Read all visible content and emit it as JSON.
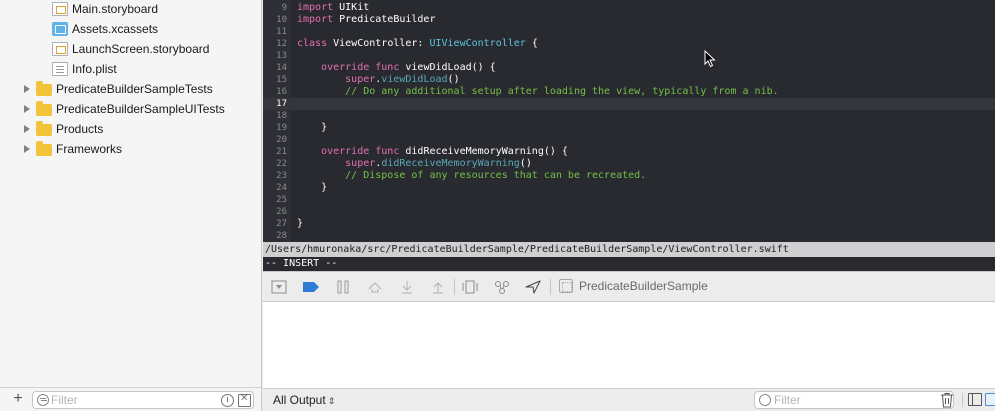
{
  "navigator": {
    "items": [
      {
        "label": "Main.storyboard",
        "icon": "storyboard-icon",
        "expandable": false
      },
      {
        "label": "Assets.xcassets",
        "icon": "asset-catalog-icon",
        "expandable": false
      },
      {
        "label": "LaunchScreen.storyboard",
        "icon": "storyboard-icon",
        "expandable": false
      },
      {
        "label": "Info.plist",
        "icon": "plist-icon",
        "expandable": false
      },
      {
        "label": "PredicateBuilderSampleTests",
        "icon": "folder-icon",
        "expandable": true
      },
      {
        "label": "PredicateBuilderSampleUITests",
        "icon": "folder-icon",
        "expandable": true
      },
      {
        "label": "Products",
        "icon": "folder-icon",
        "expandable": true
      },
      {
        "label": "Frameworks",
        "icon": "folder-icon",
        "expandable": true
      }
    ],
    "filter_placeholder": "Filter"
  },
  "editor": {
    "current_line": 17,
    "lines": [
      {
        "num": "9",
        "tokens": [
          {
            "t": "import",
            "c": "kw"
          },
          {
            "t": " UIKit",
            "c": "plain"
          }
        ]
      },
      {
        "num": "10",
        "tokens": [
          {
            "t": "import",
            "c": "kw"
          },
          {
            "t": " PredicateBuilder",
            "c": "plain"
          }
        ]
      },
      {
        "num": "11",
        "tokens": []
      },
      {
        "num": "12",
        "tokens": [
          {
            "t": "class",
            "c": "kw"
          },
          {
            "t": " ViewController: ",
            "c": "plain"
          },
          {
            "t": "UIViewController",
            "c": "type"
          },
          {
            "t": " {",
            "c": "plain"
          }
        ]
      },
      {
        "num": "13",
        "tokens": []
      },
      {
        "num": "14",
        "tokens": [
          {
            "t": "    override func",
            "c": "kw"
          },
          {
            "t": " viewDidLoad() {",
            "c": "plain"
          }
        ]
      },
      {
        "num": "15",
        "tokens": [
          {
            "t": "        super",
            "c": "kw"
          },
          {
            "t": ".",
            "c": "plain"
          },
          {
            "t": "viewDidLoad",
            "c": "fn"
          },
          {
            "t": "()",
            "c": "plain"
          }
        ]
      },
      {
        "num": "16",
        "tokens": [
          {
            "t": "        // Do any additional setup after loading the view, typically from a nib.",
            "c": "cm"
          }
        ]
      },
      {
        "num": "17",
        "tokens": []
      },
      {
        "num": "18",
        "tokens": []
      },
      {
        "num": "19",
        "tokens": [
          {
            "t": "    }",
            "c": "plain"
          }
        ]
      },
      {
        "num": "20",
        "tokens": []
      },
      {
        "num": "21",
        "tokens": [
          {
            "t": "    override func",
            "c": "kw"
          },
          {
            "t": " didReceiveMemoryWarning() {",
            "c": "plain"
          }
        ]
      },
      {
        "num": "22",
        "tokens": [
          {
            "t": "        super",
            "c": "kw"
          },
          {
            "t": ".",
            "c": "plain"
          },
          {
            "t": "didReceiveMemoryWarning",
            "c": "fn"
          },
          {
            "t": "()",
            "c": "plain"
          }
        ]
      },
      {
        "num": "23",
        "tokens": [
          {
            "t": "        // Dispose of any resources that can be recreated.",
            "c": "cm"
          }
        ]
      },
      {
        "num": "24",
        "tokens": [
          {
            "t": "    }",
            "c": "plain"
          }
        ]
      },
      {
        "num": "25",
        "tokens": []
      },
      {
        "num": "26",
        "tokens": []
      },
      {
        "num": "27",
        "tokens": [
          {
            "t": "}",
            "c": "plain"
          }
        ]
      },
      {
        "num": "28",
        "tokens": []
      }
    ]
  },
  "vim": {
    "path": "/Users/hmuronaka/src/PredicateBuilderSample/PredicateBuilderSample/ViewController.swift",
    "mode": "-- INSERT --"
  },
  "debug_bar": {
    "target": "PredicateBuilderSample"
  },
  "console": {
    "output_selector": "All Output",
    "filter_placeholder": "Filter"
  },
  "colors": {
    "editor_bg": "#292a30",
    "keyword": "#e36fb0",
    "type": "#5ec4dd",
    "function": "#57a9b8",
    "comment": "#73c046",
    "folder": "#f3c43a",
    "breakpoint_active": "#2f7bd6"
  }
}
